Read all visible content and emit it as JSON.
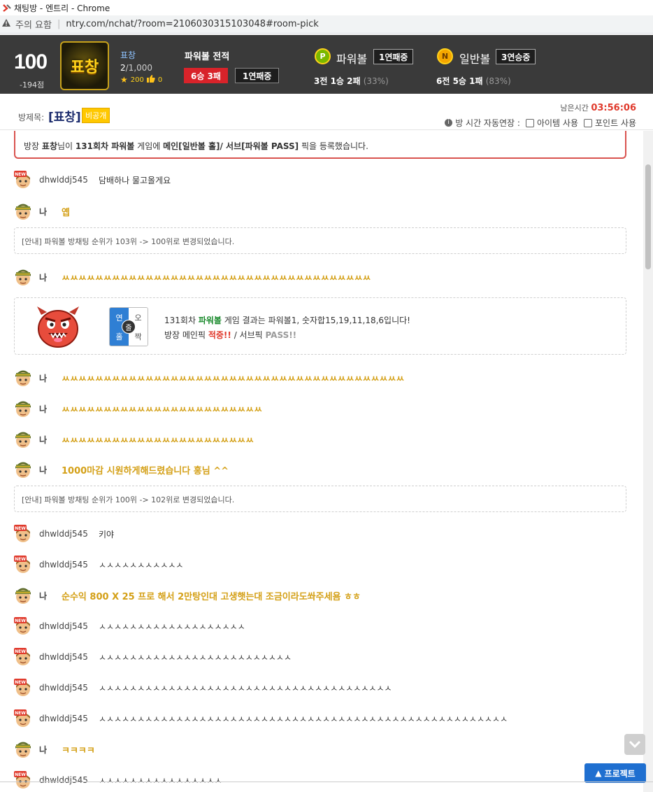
{
  "window": {
    "title": "채팅방 - 엔트리 - Chrome",
    "security_label": "주의 요함",
    "url": "ntry.com/nchat/?room=2106030315103048#room-pick"
  },
  "header": {
    "level": "100",
    "level_sub": "-194점",
    "badge_text": "표창",
    "user_name": "표창",
    "user_count_current": "2",
    "user_count_total": "/1,000",
    "stars": "200",
    "likes": "0",
    "record_title": "파워볼 전적",
    "record_wl": "6승 3패",
    "record_streak": "1연패중",
    "powerball": {
      "icon": "P",
      "name": "파워볼",
      "streak": "1연패중",
      "stat": "3전 1승 2패",
      "pct": "(33%)"
    },
    "normalball": {
      "icon": "N",
      "name": "일반볼",
      "streak": "3연승중",
      "stat": "6전 5승 1패",
      "pct": "(83%)"
    }
  },
  "room": {
    "label": "방제목:",
    "name": "[표창]",
    "public_badge": "비공개",
    "time_label": "남은시간",
    "time_value": "03:56:06",
    "auto_extend_label": "방 시간 자동연장 :",
    "opt_item": "아이템 사용",
    "opt_point": "포인트 사용"
  },
  "chat": {
    "pick_notice": {
      "pre": "방장 ",
      "host": "표창",
      "mid1": "님이 ",
      "round": "131회차 파워볼",
      "mid2": " 게임에 ",
      "main": "메인[일반볼 홀]/ 서브[파워볼 PASS]",
      "post": " 픽을 등록했습니다."
    },
    "messages": [
      {
        "nick": "dhwlddj545",
        "text": "담배하나 물고올게요",
        "me": false
      },
      {
        "nick": "나",
        "text": "옙",
        "me": true
      },
      {
        "system": "[안내] 파워볼 방채팅 순위가 103위 -> 100위로 변경되었습니다."
      },
      {
        "nick": "나",
        "text": "ㅆㅆㅆㅆㅆㅆㅆㅆㅆㅆㅆㅆㅆㅆㅆㅆㅆㅆㅆㅆㅆㅆㅆㅆㅆㅆㅆㅆㅆㅆㅆㅆㅆㅆㅆㅆㅆ",
        "me": true
      },
      {
        "result": true
      },
      {
        "nick": "나",
        "text": "ㅆㅆㅆㅆㅆㅆㅆㅆㅆㅆㅆㅆㅆㅆㅆㅆㅆㅆㅆㅆㅆㅆㅆㅆㅆㅆㅆㅆㅆㅆㅆㅆㅆㅆㅆㅆㅆㅆㅆㅆㅆ",
        "me": true
      },
      {
        "nick": "나",
        "text": "ㅆㅆㅆㅆㅆㅆㅆㅆㅆㅆㅆㅆㅆㅆㅆㅆㅆㅆㅆㅆㅆㅆㅆㅆ",
        "me": true
      },
      {
        "nick": "나",
        "text": "ㅆㅆㅆㅆㅆㅆㅆㅆㅆㅆㅆㅆㅆㅆㅆㅆㅆㅆㅆㅆㅆㅆㅆ",
        "me": true
      },
      {
        "nick": "나",
        "text": "1000마감 시원하게해드렸습니다 홍님 ^^",
        "me": true
      },
      {
        "system": "[안내] 파워볼 방채팅 순위가 100위 -> 102위로 변경되었습니다."
      },
      {
        "nick": "dhwlddj545",
        "text": "키야",
        "me": false
      },
      {
        "nick": "dhwlddj545",
        "text": "ㅅㅅㅅㅅㅅㅅㅅㅅㅅㅅㅅ",
        "me": false
      },
      {
        "nick": "나",
        "text": "순수익 800 X 25 프로 해서 2만탕인대 고생햇는대 조금이라도쏴주세욤 ㅎㅎ",
        "me": true
      },
      {
        "nick": "dhwlddj545",
        "text": "ㅅㅅㅅㅅㅅㅅㅅㅅㅅㅅㅅㅅㅅㅅㅅㅅㅅㅅㅅ",
        "me": false
      },
      {
        "nick": "dhwlddj545",
        "text": "ㅅㅅㅅㅅㅅㅅㅅㅅㅅㅅㅅㅅㅅㅅㅅㅅㅅㅅㅅㅅㅅㅅㅅㅅㅅ",
        "me": false
      },
      {
        "nick": "dhwlddj545",
        "text": "ㅅㅅㅅㅅㅅㅅㅅㅅㅅㅅㅅㅅㅅㅅㅅㅅㅅㅅㅅㅅㅅㅅㅅㅅㅅㅅㅅㅅㅅㅅㅅㅅㅅㅅㅅㅅㅅㅅ",
        "me": false
      },
      {
        "nick": "dhwlddj545",
        "text": "ㅅㅅㅅㅅㅅㅅㅅㅅㅅㅅㅅㅅㅅㅅㅅㅅㅅㅅㅅㅅㅅㅅㅅㅅㅅㅅㅅㅅㅅㅅㅅㅅㅅㅅㅅㅅㅅㅅㅅㅅㅅㅅㅅㅅㅅㅅㅅㅅㅅㅅㅅㅅㅅ",
        "me": false
      },
      {
        "nick": "나",
        "text": "ㅋㅋㅋㅋ",
        "me": true
      },
      {
        "nick": "dhwlddj545",
        "text": "ㅅㅅㅅㅅㅅㅅㅅㅅㅅㅅㅅㅅㅅㅅㅅㅅ",
        "me": false
      }
    ],
    "result": {
      "oe_labels": [
        "연",
        "오",
        "홀",
        "짝"
      ],
      "oe_center": "줄",
      "line1_pre": "131회차 ",
      "line1_game": "파워볼",
      "line1_post": " 게임 결과는 파워볼1, 숫자합15,19,11,18,6입니다!",
      "line2_pre": "방장 메인픽 ",
      "line2_hit": "적중!!",
      "line2_mid": " / 서브픽 ",
      "line2_pass": "PASS!!"
    }
  },
  "buttons": {
    "project": "프로젝트"
  },
  "colors": {
    "header_bg": "#3a3a3a",
    "accent_red": "#d8232a",
    "my_text": "#d4a017",
    "project_btn": "#1f6fd0"
  }
}
